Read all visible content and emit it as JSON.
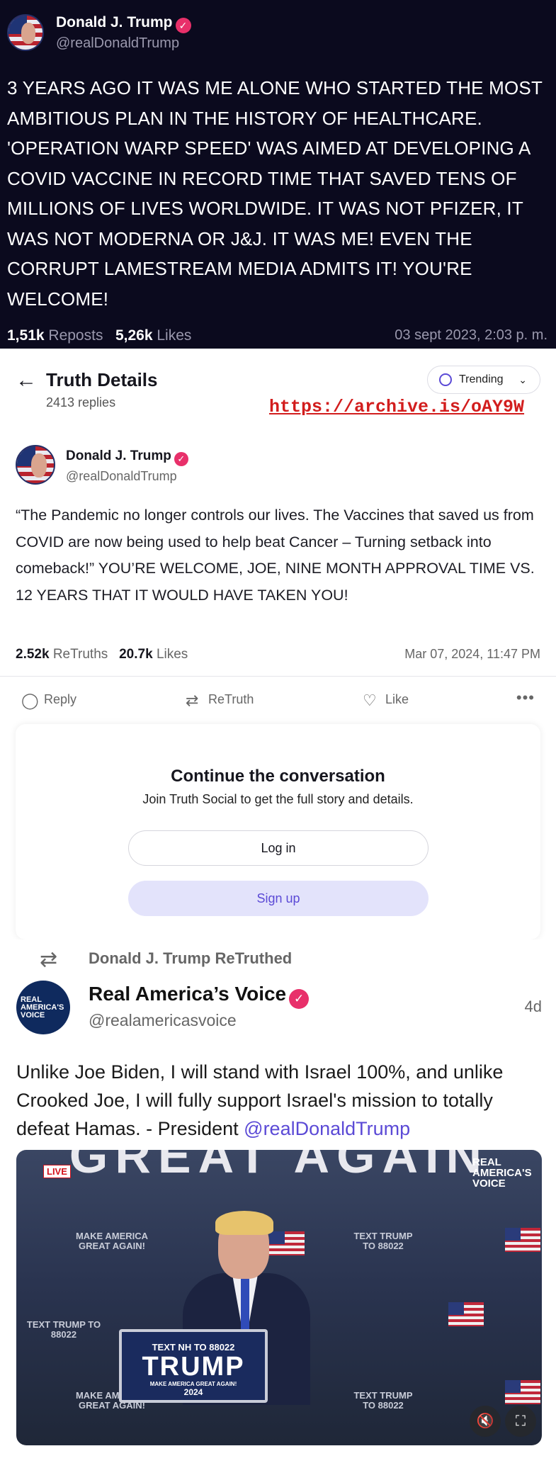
{
  "post1": {
    "name": "Donald J. Trump",
    "handle": "@realDonaldTrump",
    "body": "3 YEARS AGO IT WAS ME ALONE WHO STARTED THE MOST AMBITIOUS PLAN IN THE HISTORY OF HEALTHCARE. 'OPERATION WARP SPEED' WAS AIMED AT DEVELOPING A COVID VACCINE IN RECORD TIME THAT SAVED TENS OF MILLIONS OF LIVES WORLDWIDE. IT WAS NOT PFIZER, IT WAS NOT MODERNA OR J&J. IT WAS ME! EVEN THE CORRUPT LAMESTREAM MEDIA ADMITS IT! YOU'RE WELCOME!",
    "reposts_count": "1,51k",
    "reposts_label": "Reposts",
    "likes_count": "5,26k",
    "likes_label": "Likes",
    "date": "03 sept 2023, 2:03 p. m.",
    "colors": {
      "background": "#0b0a1e",
      "verified": "#e8306a"
    }
  },
  "post2": {
    "header_title": "Truth Details",
    "replies": "2413 replies",
    "trending_label": "Trending",
    "archive_link": "https://archive.is/oAY9W",
    "name": "Donald J. Trump",
    "handle": "@realDonaldTrump",
    "body": "“The Pandemic no longer controls our lives. The Vaccines that saved us from COVID are now being used to help beat Cancer – Turning setback into comeback!” YOU’RE WELCOME, JOE, NINE MONTH APPROVAL TIME VS. 12 YEARS THAT IT WOULD HAVE TAKEN YOU!",
    "retruths_count": "2.52k",
    "retruths_label": "ReTruths",
    "likes_count": "20.7k",
    "likes_label": "Likes",
    "date": "Mar 07, 2024, 11:47 PM",
    "actions": {
      "reply": "Reply",
      "retruth": "ReTruth",
      "like": "Like"
    },
    "cta": {
      "title": "Continue the conversation",
      "subtitle": "Join Truth Social to get the full story and details.",
      "login": "Log in",
      "signup": "Sign up"
    },
    "colors": {
      "link": "#d21d1d",
      "accent": "#5b4ad6",
      "signup_bg": "#e3e3fb"
    }
  },
  "post3": {
    "retruthed_by": "Donald J. Trump ReTruthed",
    "name": "Real America’s Voice",
    "handle": "@realamericasvoice",
    "age": "4d",
    "body_prefix": "Unlike Joe Biden, I will stand with Israel 100%, and unlike Crooked Joe, I will fully support Israel's mission to totally defeat Hamas. - President ",
    "mention": "@realDonaldTrump",
    "media": {
      "banner": "GREAT AGAIN",
      "live_badge": "LIVE",
      "channel_logo": "REAL AMERICA'S VOICE",
      "podium_line1": "TEXT NH TO 88022",
      "podium_name": "TRUMP",
      "podium_tagline": "MAKE AMERICA GREAT AGAIN!",
      "podium_year": "2024",
      "sign_maga": "MAKE AMERICA GREAT AGAIN!",
      "sign_text": "TEXT TRUMP TO 88022"
    },
    "avatar_text": "REAL AMERICA'S VOICE"
  }
}
